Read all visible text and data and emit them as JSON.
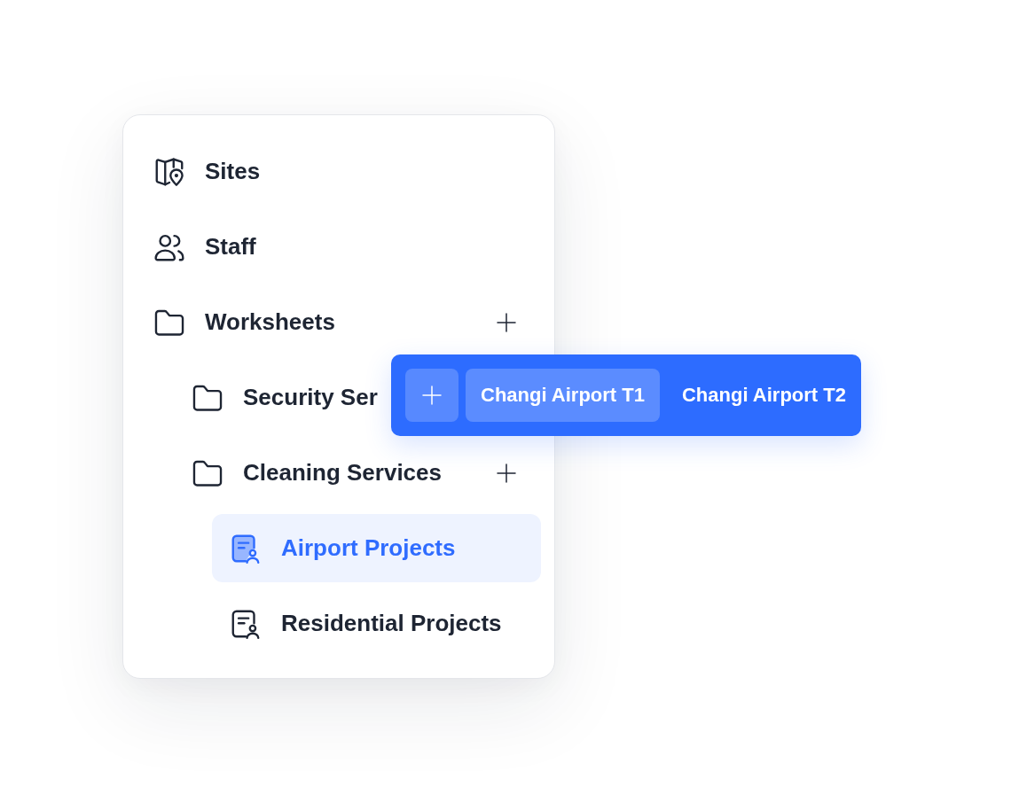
{
  "sidebar": {
    "items": [
      {
        "label": "Sites",
        "kind": "map",
        "selected": false,
        "add_button": false
      },
      {
        "label": "Staff",
        "kind": "people",
        "selected": false,
        "add_button": false
      },
      {
        "label": "Worksheets",
        "kind": "folder",
        "selected": false,
        "add_button": true,
        "children": [
          {
            "label": "Security Ser",
            "kind": "folder",
            "selected": false,
            "add_button": false
          },
          {
            "label": "Cleaning Services",
            "kind": "folder",
            "selected": false,
            "add_button": true,
            "children": [
              {
                "label": "Airport Projects",
                "kind": "sheet",
                "selected": true,
                "add_button": false
              },
              {
                "label": "Residential Projects",
                "kind": "sheet",
                "selected": false,
                "add_button": false
              }
            ]
          }
        ]
      }
    ]
  },
  "location_bar": {
    "add_button": true,
    "items": [
      {
        "label": "Changi Airport T1",
        "selected": true
      },
      {
        "label": "Changi Airport T2",
        "selected": false
      }
    ]
  }
}
